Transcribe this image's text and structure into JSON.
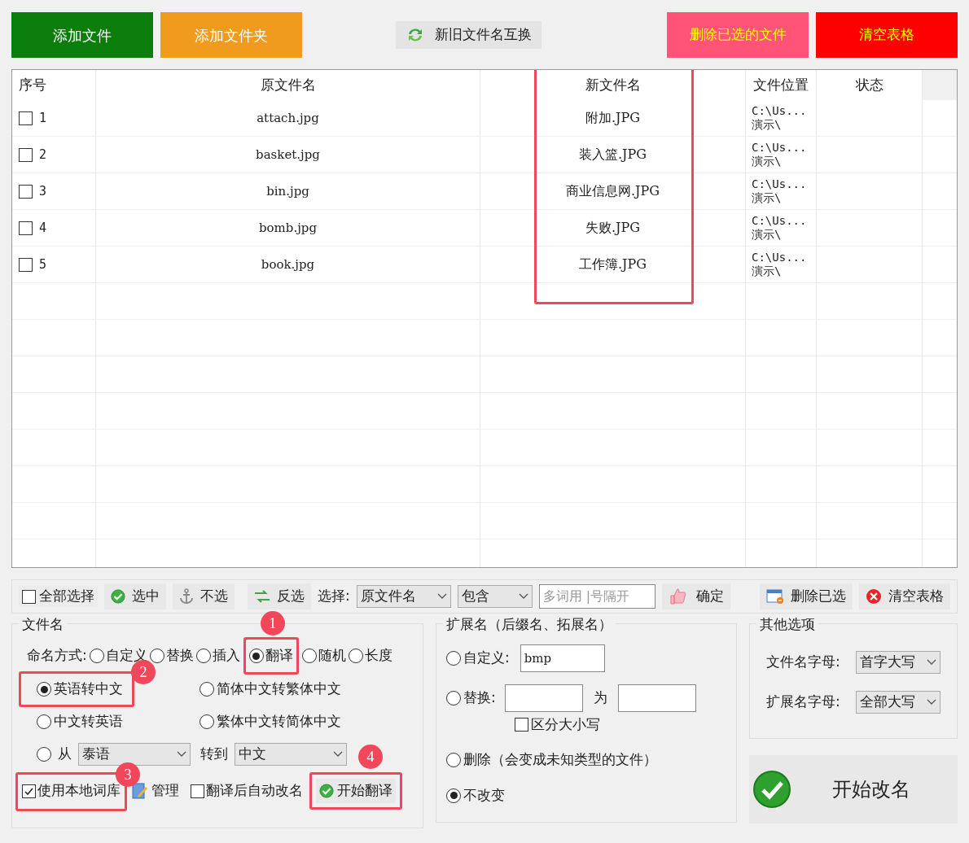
{
  "top_buttons": [
    {
      "label": "添加文件",
      "color": "#0a7d0a"
    },
    {
      "label": "添加文件夹",
      "color": "#f09b1e"
    }
  ],
  "swap_button": {
    "label": "新旧文件名互换"
  },
  "top_right_buttons": [
    {
      "label": "删除已选的文件",
      "color": "#ff5478"
    },
    {
      "label": "清空表格",
      "color": "#ff0000"
    }
  ],
  "table": {
    "columns": [
      "序号",
      "原文件名",
      "新文件名",
      "文件位置",
      "状态"
    ],
    "highlight_callout": true,
    "rows": [
      {
        "checked": false,
        "index": "1",
        "original": "attach.jpg",
        "new": "附加.JPG",
        "location": [
          "C:\\Us...",
          "演示\\"
        ]
      },
      {
        "checked": false,
        "index": "2",
        "original": "basket.jpg",
        "new": "装入篮.JPG",
        "location": [
          "C:\\Us...",
          "演示\\"
        ]
      },
      {
        "checked": false,
        "index": "3",
        "original": "bin.jpg",
        "new": "商业信息网.JPG",
        "location": [
          "C:\\Us...",
          "演示\\"
        ]
      },
      {
        "checked": false,
        "index": "4",
        "original": "bomb.jpg",
        "new": "失败.JPG",
        "location": [
          "C:\\Us...",
          "演示\\"
        ]
      },
      {
        "checked": false,
        "index": "5",
        "original": "book.jpg",
        "new": "工作簿.JPG",
        "location": [
          "C:\\Us...",
          "演示\\"
        ]
      }
    ]
  },
  "selection_bar": {
    "select_all": {
      "label": "全部选择",
      "checked": false
    },
    "select": "选中",
    "deselect": "不选",
    "invert": "反选",
    "filter_label": "选择:",
    "filter_field": "原文件名",
    "filter_mode": "包含",
    "keyword_placeholder": "多词用 |号隔开",
    "confirm": "确定",
    "delete_selected": "删除已选",
    "clear_table": "清空表格"
  },
  "filename_group": {
    "title": "文件名",
    "naming_label": "命名方式:",
    "naming_modes": [
      {
        "label": "自定义",
        "selected": false
      },
      {
        "label": "替换",
        "selected": false
      },
      {
        "label": "插入",
        "selected": false
      },
      {
        "label": "翻译",
        "selected": true,
        "callout": "1"
      },
      {
        "label": "随机",
        "selected": false
      },
      {
        "label": "长度",
        "selected": false
      }
    ],
    "translate_options": [
      {
        "label": "英语转中文",
        "selected": true,
        "callout": "2"
      },
      {
        "label": "简体中文转繁体中文",
        "selected": false
      },
      {
        "label": "中文转英语",
        "selected": false
      },
      {
        "label": "繁体中文转简体中文",
        "selected": false
      }
    ],
    "from": {
      "label": "从",
      "selected": false,
      "value": "泰语"
    },
    "to": {
      "label": "转到",
      "value": "中文"
    },
    "use_local": {
      "label": "使用本地词库",
      "checked": true,
      "callout": "3"
    },
    "manage": "管理",
    "auto_rename": {
      "label": "翻译后自动改名",
      "checked": false
    },
    "start_translate": {
      "label": "开始翻译",
      "callout": "4"
    }
  },
  "extension_group": {
    "title": "扩展名（后缀名、拓展名）",
    "options": [
      {
        "kind": "custom",
        "label": "自定义:",
        "selected": false,
        "value": "bmp"
      },
      {
        "kind": "replace",
        "label": "替换:",
        "selected": false,
        "joiner": "为",
        "case_label": "区分大小写",
        "case_checked": false
      },
      {
        "kind": "plain",
        "label": "删除（会变成未知类型的文件）",
        "selected": false
      },
      {
        "kind": "plain",
        "label": "不改变",
        "selected": true
      }
    ]
  },
  "other_options": {
    "title": "其他选项",
    "fields": [
      {
        "label": "文件名字母:",
        "value": "首字大写"
      },
      {
        "label": "扩展名字母:",
        "value": "全部大写"
      }
    ]
  },
  "start_rename": "开始改名"
}
